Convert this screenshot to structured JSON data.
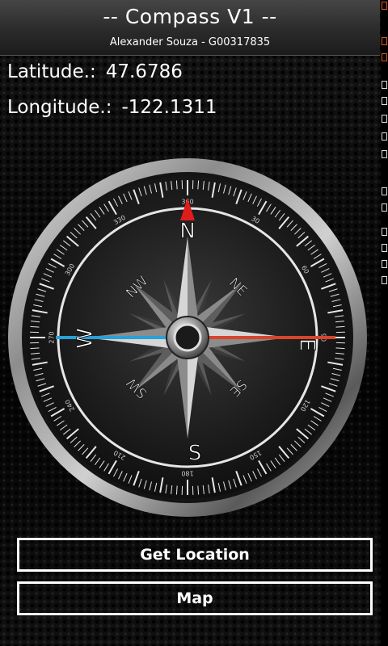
{
  "app": {
    "title": "-- Compass V1 --",
    "subtitle": "Alexander Souza - G00317835"
  },
  "location": {
    "latitude_label": "Latitude.:",
    "latitude_value": "47.6786",
    "longitude_label": "Longitude.:",
    "longitude_value": "-122.1311"
  },
  "compass": {
    "cardinals": [
      "N",
      "E",
      "S",
      "W"
    ],
    "intercardinals": [
      "NE",
      "SE",
      "SW",
      "NW"
    ],
    "degree_labels": [
      "360",
      "30",
      "60",
      "90",
      "120",
      "150",
      "180",
      "210",
      "240",
      "270",
      "300",
      "330"
    ],
    "needle_colors": {
      "north": "#e01c1c",
      "east": "#d8452a",
      "west": "#2aa0d8"
    }
  },
  "buttons": {
    "get_location": "Get Location",
    "map": "Map"
  },
  "colors": {
    "accent": "#ffffff",
    "status_indicator": "#e0531c"
  }
}
